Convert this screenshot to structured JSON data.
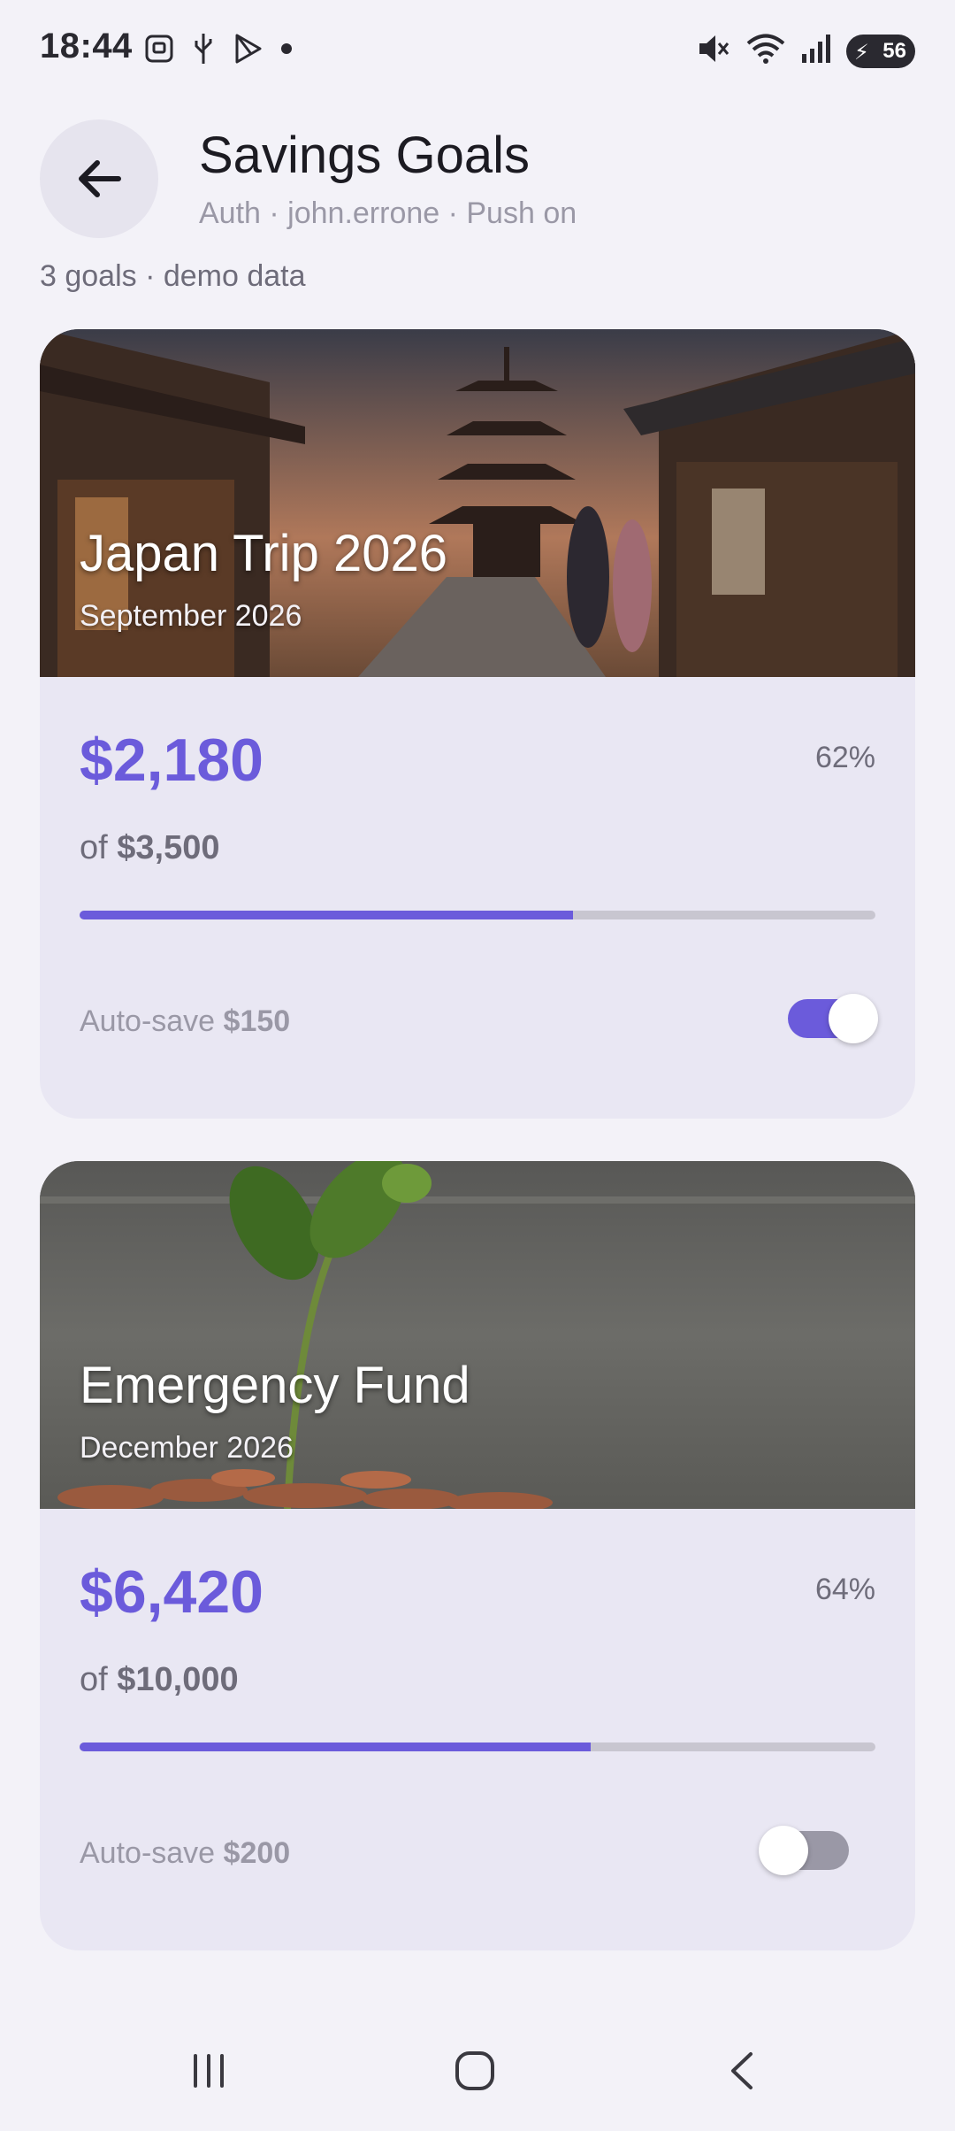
{
  "status_bar": {
    "time": "18:44",
    "battery_level": "56",
    "left_icons": [
      "screenshot-icon",
      "usb-icon",
      "play-store-icon",
      "notification-dot-icon"
    ],
    "right_icons": [
      "mute-icon",
      "wifi-icon",
      "signal-icon",
      "battery-icon"
    ]
  },
  "header": {
    "title": "Savings Goals",
    "subtitle": "Auth · john.errone · Push on",
    "summary": "3 goals · demo data"
  },
  "goals": [
    {
      "title": "Japan Trip 2026",
      "date": "September 2026",
      "amount": "$2,180",
      "percent": "62%",
      "progress": 0.62,
      "target_prefix": "of",
      "target": "$3,500",
      "autosave_label": "Auto-save",
      "autosave_amount": "$150",
      "autosave_on": true
    },
    {
      "title": "Emergency Fund",
      "date": "December 2026",
      "amount": "$6,420",
      "percent": "64%",
      "progress": 0.642,
      "target_prefix": "of",
      "target": "$10,000",
      "autosave_label": "Auto-save",
      "autosave_amount": "$200",
      "autosave_on": false
    }
  ],
  "colors": {
    "accent": "#6B5BDB",
    "background": "#F3F2F8",
    "card": "#E9E7F3"
  }
}
